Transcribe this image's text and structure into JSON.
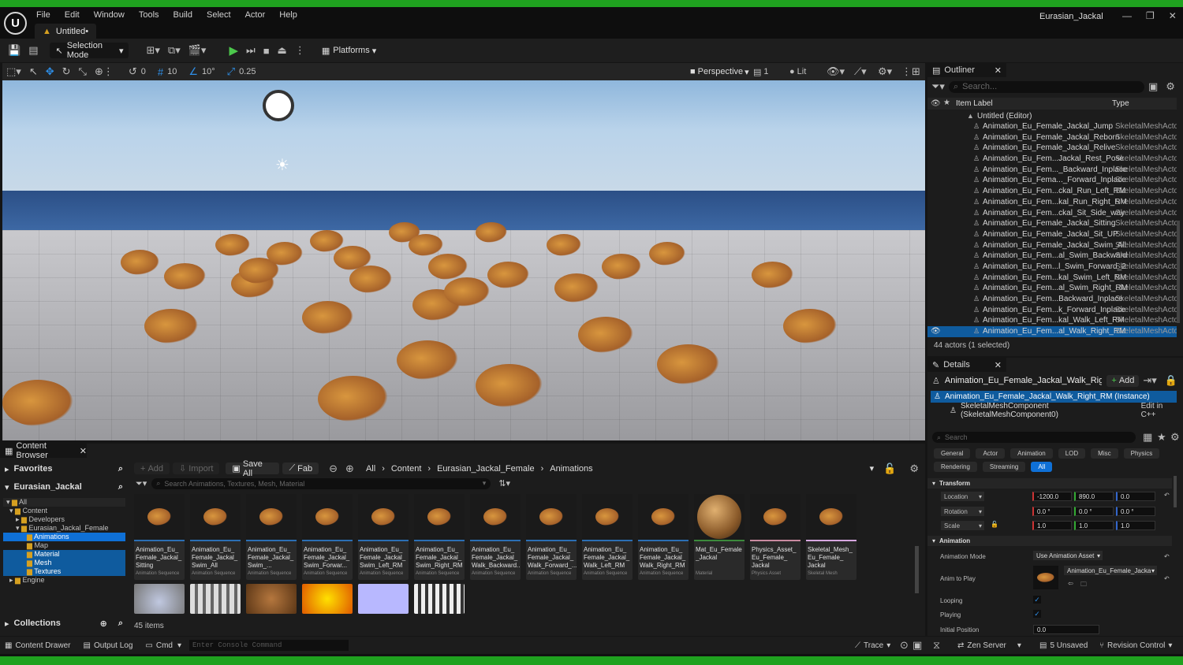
{
  "title_bar": {
    "menu": [
      "File",
      "Edit",
      "Window",
      "Tools",
      "Build",
      "Select",
      "Actor",
      "Help"
    ],
    "project": "Eurasian_Jackal",
    "tab": "Untitled•"
  },
  "toolbar": {
    "mode": "Selection Mode",
    "platforms": "Platforms"
  },
  "viewport_toolbar": {
    "rotate": "0",
    "grid": "10",
    "angle": "10°",
    "scale": "0.25",
    "view": "Perspective",
    "lit": "Lit",
    "camera_speed": "1"
  },
  "outliner": {
    "title": "Outliner",
    "search_placeholder": "Search...",
    "col_label": "Item Label",
    "col_type": "Type",
    "root": "Untitled (Editor)",
    "items": [
      {
        "name": "Animation_Eu_Female_Jackal_Jump",
        "type": "SkeletalMeshActor"
      },
      {
        "name": "Animation_Eu_Female_Jackal_Reborn",
        "type": "SkeletalMeshActor"
      },
      {
        "name": "Animation_Eu_Female_Jackal_Relive",
        "type": "SkeletalMeshActor"
      },
      {
        "name": "Animation_Eu_Fem...Jackal_Rest_Pose",
        "type": "SkeletalMeshActor"
      },
      {
        "name": "Animation_Eu_Fem..._Backward_Inplace",
        "type": "SkeletalMeshActor"
      },
      {
        "name": "Animation_Eu_Fema..._Forward_Inplace",
        "type": "SkeletalMeshActor"
      },
      {
        "name": "Animation_Eu_Fem...ckal_Run_Left_RM",
        "type": "SkeletalMeshActor"
      },
      {
        "name": "Animation_Eu_Fem...kal_Run_Right_RM",
        "type": "SkeletalMeshActor"
      },
      {
        "name": "Animation_Eu_Fem...ckal_Sit_Side_way",
        "type": "SkeletalMeshActor"
      },
      {
        "name": "Animation_Eu_Female_Jackal_Sitting",
        "type": "SkeletalMeshActor"
      },
      {
        "name": "Animation_Eu_Female_Jackal_Sit_UP",
        "type": "SkeletalMeshActor"
      },
      {
        "name": "Animation_Eu_Female_Jackal_Swim_All",
        "type": "SkeletalMeshActor"
      },
      {
        "name": "Animation_Eu_Fem...al_Swim_Backward",
        "type": "SkeletalMeshActor"
      },
      {
        "name": "Animation_Eu_Fem...l_Swim_Forward_2",
        "type": "SkeletalMeshActor"
      },
      {
        "name": "Animation_Eu_Fem...kal_Swim_Left_RM",
        "type": "SkeletalMeshActor"
      },
      {
        "name": "Animation_Eu_Fem...al_Swim_Right_RM",
        "type": "SkeletalMeshActor"
      },
      {
        "name": "Animation_Eu_Fem...Backward_Inplace",
        "type": "SkeletalMeshActor"
      },
      {
        "name": "Animation_Eu_Fem...k_Forward_Inplace",
        "type": "SkeletalMeshActor"
      },
      {
        "name": "Animation_Eu_Fem...kal_Walk_Left_RM",
        "type": "SkeletalMeshActor"
      },
      {
        "name": "Animation_Eu_Fem...al_Walk_Right_RM",
        "type": "SkeletalMeshActor"
      }
    ],
    "footer": "44 actors (1 selected)"
  },
  "details": {
    "title": "Details",
    "actor": "Animation_Eu_Female_Jackal_Walk_Right_I",
    "add": "Add",
    "instance": "Animation_Eu_Female_Jackal_Walk_Right_RM (Instance)",
    "component": "SkeletalMeshComponent (SkeletalMeshComponent0)",
    "edit_cpp": "Edit in C++",
    "search_placeholder": "Search",
    "filters_row1": [
      "General",
      "Actor",
      "Animation",
      "LOD",
      "Misc",
      "Physics"
    ],
    "filters_row2": [
      "Rendering",
      "Streaming",
      "All"
    ],
    "transform_header": "Transform",
    "location_label": "Location",
    "rotation_label": "Rotation",
    "scale_label": "Scale",
    "location": [
      "-1200.0",
      "890.0",
      "0.0"
    ],
    "rotation": [
      "0.0 °",
      "0.0 °",
      "0.0 °"
    ],
    "scale": [
      "1.0",
      "1.0",
      "1.0"
    ],
    "animation_header": "Animation",
    "anim_mode_label": "Animation Mode",
    "anim_mode": "Use Animation Asset",
    "anim_to_play_label": "Anim to Play",
    "anim_to_play": "Animation_Eu_Female_Jacka",
    "looping_label": "Looping",
    "playing_label": "Playing",
    "initial_position_label": "Initial Position",
    "initial_position": "0.0"
  },
  "content_browser": {
    "tab": "Content Browser",
    "favorites": "Favorites",
    "project": "Eurasian_Jackal",
    "add": "Add",
    "import": "Import",
    "save_all": "Save All",
    "fab": "Fab",
    "path": [
      "All",
      "Content",
      "Eurasian_Jackal_Female",
      "Animations"
    ],
    "search_placeholder": "Search Animations, Textures, Mesh, Material",
    "tree": [
      "All",
      "Content",
      "Developers",
      "Eurasian_Jackal_Female",
      "Animations",
      "Map",
      "Material",
      "Mesh",
      "Textures",
      "Engine"
    ],
    "collections": "Collections",
    "count": "45 items",
    "assets": [
      {
        "label": "Animation_Eu_\nFemale_Jackal_\nSitting",
        "type": "Animation Sequence"
      },
      {
        "label": "Animation_Eu_\nFemale_Jackal_\nSwim_All",
        "type": "Animation Sequence"
      },
      {
        "label": "Animation_Eu_\nFemale_Jackal_\nSwim_...",
        "type": "Animation Sequence"
      },
      {
        "label": "Animation_Eu_\nFemale_Jackal_\nSwim_Forwar...",
        "type": "Animation Sequence"
      },
      {
        "label": "Animation_Eu_\nFemale_Jackal_\nSwim_Left_RM",
        "type": "Animation Sequence"
      },
      {
        "label": "Animation_Eu_\nFemale_Jackal_\nSwim_Right_RM",
        "type": "Animation Sequence"
      },
      {
        "label": "Animation_Eu_\nFemale_Jackal_\nWalk_Backward...",
        "type": "Animation Sequence"
      },
      {
        "label": "Animation_Eu_\nFemale_Jackal_\nWalk_Forward_...",
        "type": "Animation Sequence"
      },
      {
        "label": "Animation_Eu_\nFemale_Jackal_\nWalk_Left_RM",
        "type": "Animation Sequence"
      },
      {
        "label": "Animation_Eu_\nFemale_Jackal_\nWalk_Right_RM",
        "type": "Animation Sequence"
      },
      {
        "label": "Mat_Eu_Female\n_Jackal",
        "type": "Material"
      },
      {
        "label": "Physics_Asset_\nEu_Female_\nJackal",
        "type": "Physics Asset"
      },
      {
        "label": "Skeletal_Mesh_\nEu_Female_\nJackal",
        "type": "Skeletal Mesh"
      }
    ]
  },
  "status_bar": {
    "content_drawer": "Content Drawer",
    "output_log": "Output Log",
    "cmd": "Cmd",
    "console_placeholder": "Enter Console Command",
    "trace": "Trace",
    "zen": "Zen Server",
    "unsaved": "5 Unsaved",
    "revision": "Revision Control"
  },
  "colors": {
    "accent": "#0f70d6",
    "status_green": "#1fa11f",
    "selection": "#0f5b9e"
  }
}
